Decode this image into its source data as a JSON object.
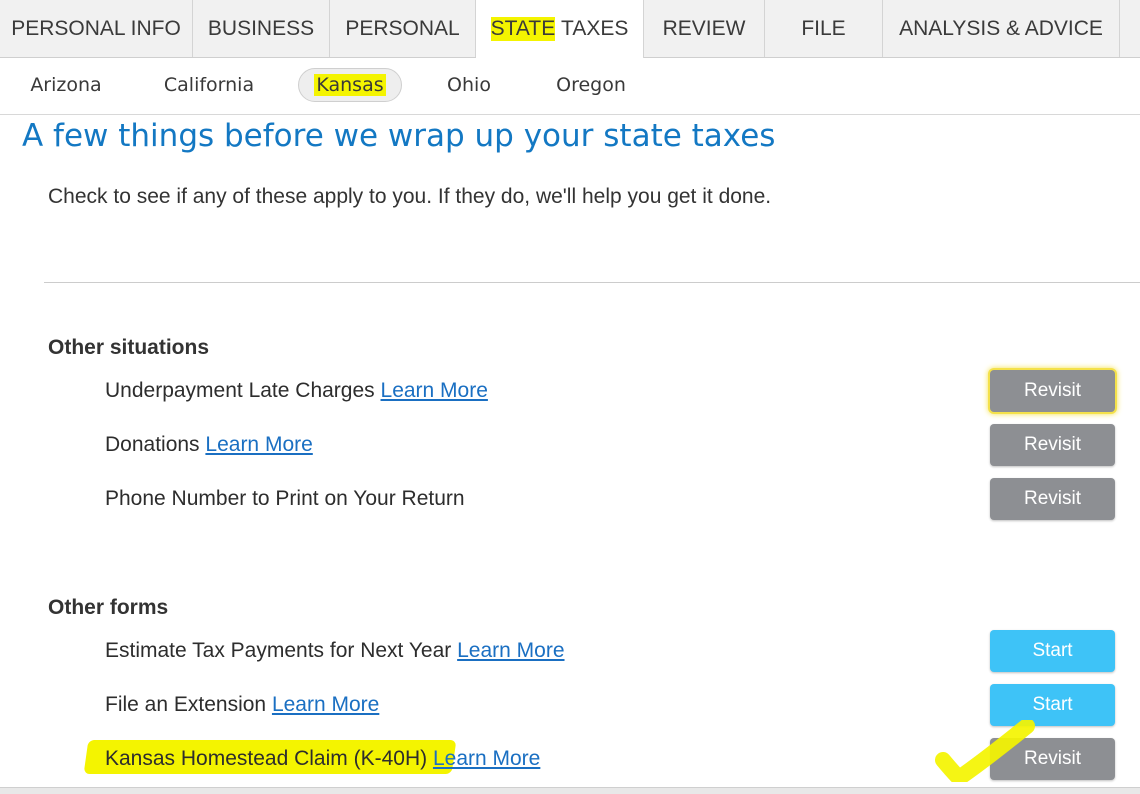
{
  "top_tabs": [
    "PERSONAL INFO",
    "BUSINESS",
    "PERSONAL",
    "STATE",
    "TAXES",
    "REVIEW",
    "FILE",
    "ANALYSIS & ADVICE"
  ],
  "state_tabs": [
    "Arizona",
    "California",
    "Kansas",
    "Ohio",
    "Oregon"
  ],
  "page": {
    "title": "A few things before we wrap up your state taxes",
    "intro": "Check to see if any of these apply to you. If they do, we'll help you get it done."
  },
  "other_situations": {
    "heading": "Other situations",
    "items": [
      {
        "label": "Underpayment Late Charges",
        "link": "Learn More",
        "button": "Revisit"
      },
      {
        "label": "Donations",
        "link": "Learn More",
        "button": "Revisit"
      },
      {
        "label": "Phone Number to Print on Your Return",
        "button": "Revisit"
      }
    ]
  },
  "other_forms": {
    "heading": "Other forms",
    "items": [
      {
        "label": "Estimate Tax Payments for Next Year",
        "link": "Learn More",
        "button": "Start"
      },
      {
        "label": "File an Extension",
        "link": "Learn More",
        "button": "Start"
      },
      {
        "label": "Kansas Homestead Claim (K-40H)",
        "link": "Learn More",
        "button": "Revisit"
      }
    ]
  },
  "colors": {
    "title_blue": "#1378c3",
    "link_blue": "#1a6fc2",
    "revisit_gray": "#8d8f93",
    "start_blue": "#3ec3f7",
    "highlight_yellow": "#f4f400"
  }
}
